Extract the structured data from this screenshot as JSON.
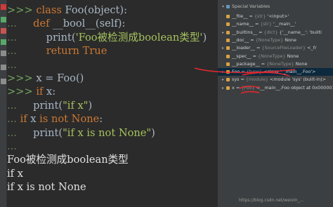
{
  "toolbar": {
    "buttons": [
      {
        "icon": "rerun-icon",
        "color": "#d13a3a"
      },
      {
        "icon": "run-icon",
        "color": "#59a869"
      },
      {
        "icon": "stop-icon",
        "color": "#c75450"
      },
      {
        "icon": "debug-icon",
        "color": "#59a869"
      },
      {
        "icon": "clear-icon",
        "color": "#8c8c8c"
      },
      {
        "icon": "settings-icon",
        "color": "#8c8c8c"
      },
      {
        "icon": "add-icon",
        "color": "#8c8c8c"
      }
    ]
  },
  "console": {
    "lines": [
      {
        "prompt": ">>>",
        "code": " class Foo(object):"
      },
      {
        "prompt": "...",
        "code": "     def __bool__(self):"
      },
      {
        "prompt": "...",
        "code": "         print('Foo被检测成boolean类型')"
      },
      {
        "prompt": "...",
        "code": "         return True"
      },
      {
        "prompt": "...",
        "code": ""
      },
      {
        "prompt": ">>>",
        "code": " x = Foo()"
      },
      {
        "prompt": ">>>",
        "code": " if x:"
      },
      {
        "prompt": "...",
        "code": "     print(\"if x\")"
      },
      {
        "prompt": "...",
        "code": " if x is not None:"
      },
      {
        "prompt": "...",
        "code": "     print(\"if x is not None\")"
      },
      {
        "prompt": "...",
        "code": ""
      },
      {
        "prompt": "",
        "code": "Foo被检测成boolean类型"
      },
      {
        "prompt": "",
        "code": "if x"
      },
      {
        "prompt": "",
        "code": "if x is not None"
      }
    ]
  },
  "variables": {
    "header": "Special Variables",
    "rows": [
      {
        "name": "__file__",
        "type": "{str}",
        "value": "'<input>'"
      },
      {
        "name": "__name__",
        "type": "{str}",
        "value": "'__main__'"
      },
      {
        "name": "__builtins__",
        "type": "{dict}",
        "value": "{'__name__': 'builti"
      },
      {
        "name": "__doc__",
        "type": "{NoneType}",
        "value": "None"
      },
      {
        "name": "__loader__",
        "type": "{SourceFileLoader}",
        "value": "<_fr"
      },
      {
        "name": "__spec__",
        "type": "{NoneType}",
        "value": "None"
      },
      {
        "name": "__package__",
        "type": "{NoneType}",
        "value": "None"
      },
      {
        "name": "Foo",
        "type": "{type}",
        "value": "<class '__main__.Foo'>"
      },
      {
        "name": "sys",
        "type": "{module}",
        "value": "<module 'sys' (built-in)>"
      },
      {
        "name": "x",
        "type": "{Foo}",
        "value": "<__main__.Foo object at 0x0000014FF"
      }
    ]
  },
  "watermark": "https://blog.csdn.net/weixin_...",
  "colors": {
    "annotation": "#e0282d",
    "background": "#2b2b2b",
    "panel": "#3c3f41"
  }
}
